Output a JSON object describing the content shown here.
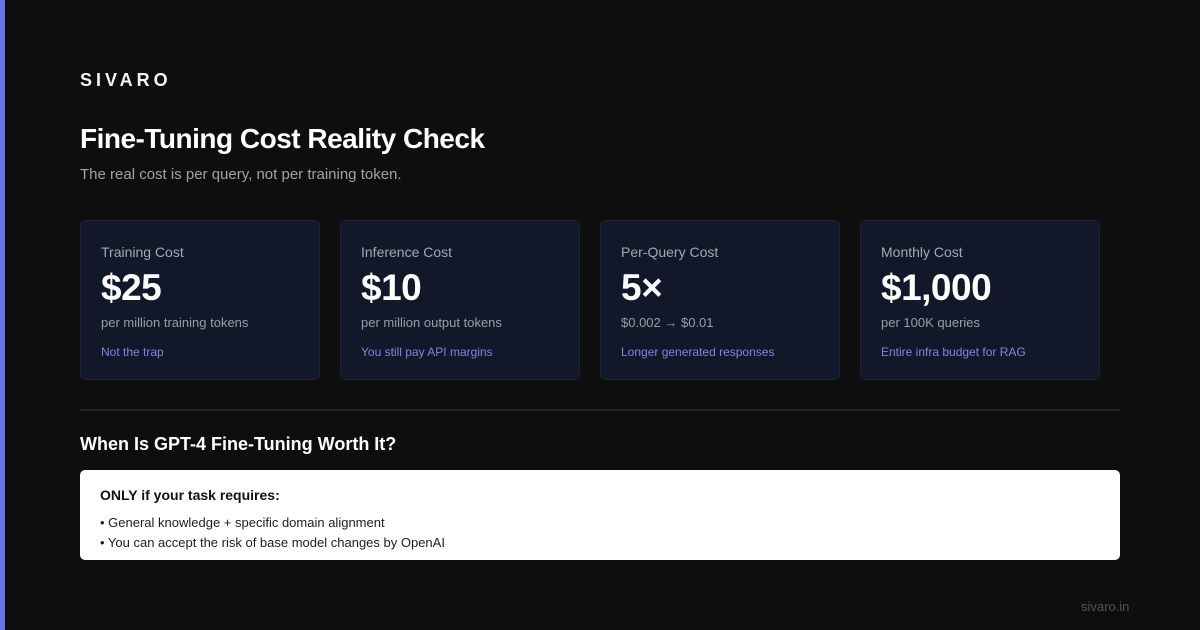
{
  "brand": "SIVARO",
  "accent_color": "#6b74e0",
  "title": "Fine-Tuning Cost Reality Check",
  "subtitle": "The real cost is per query, not per training token.",
  "cards": [
    {
      "label": "Training Cost",
      "value": "$25",
      "description": "per million training tokens",
      "note": "Not the trap"
    },
    {
      "label": "Inference Cost",
      "value": "$10",
      "description": "per million output tokens",
      "note": "You still pay API margins"
    },
    {
      "label": "Per-Query Cost",
      "value": "5×",
      "description": "$0.002 → $0.01",
      "note": "Longer generated responses"
    },
    {
      "label": "Monthly Cost",
      "value": "$1,000",
      "description": "per 100K queries",
      "note": "Entire infra budget for RAG"
    }
  ],
  "section": {
    "title": "When Is GPT-4 Fine-Tuning Worth It?",
    "callout_heading": "ONLY if your task requires:",
    "bullets": [
      "• General knowledge + specific domain alignment",
      "• You can accept the risk of base model changes by OpenAI"
    ]
  },
  "footer_url": "sivaro.in"
}
